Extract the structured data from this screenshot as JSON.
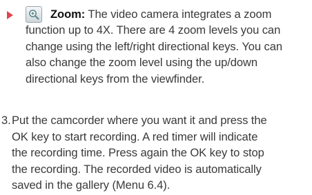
{
  "zoom_item": {
    "icon": "zoom-in-icon",
    "bullet_color": "#e0464f",
    "title": "Zoom:",
    "first_line_rest": "The video camera integrates a zoom",
    "lines": [
      "function up to 4X. There are 4 zoom levels you can",
      "change using the left/right directional keys. You can",
      "also change the zoom level using the up/down",
      "directional keys from the viewfinder."
    ]
  },
  "step3": {
    "number": "3.",
    "first_line": "Put the camcorder where you want it and press the",
    "lines": [
      "OK key to start recording. A red timer will indicate",
      "the recording time. Press again the OK key to stop",
      "the recording. The recorded video is automatically",
      "saved in the gallery (Menu 6.4)."
    ]
  }
}
